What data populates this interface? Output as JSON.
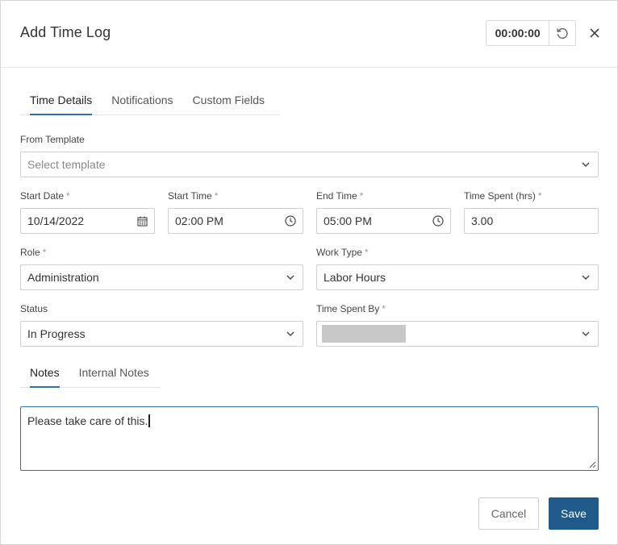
{
  "dialog": {
    "title": "Add Time Log",
    "timer": "00:00:00"
  },
  "tabs": [
    {
      "label": "Time Details",
      "active": true
    },
    {
      "label": "Notifications",
      "active": false
    },
    {
      "label": "Custom Fields",
      "active": false
    }
  ],
  "form": {
    "from_template": {
      "label": "From Template",
      "placeholder": "Select template"
    },
    "start_date": {
      "label": "Start Date",
      "required": "*",
      "value": "10/14/2022"
    },
    "start_time": {
      "label": "Start Time",
      "required": "*",
      "value": "02:00 PM"
    },
    "end_time": {
      "label": "End Time",
      "required": "*",
      "value": "05:00 PM"
    },
    "time_spent": {
      "label": "Time Spent (hrs)",
      "required": "*",
      "value": "3.00"
    },
    "role": {
      "label": "Role",
      "required": "*",
      "value": "Administration"
    },
    "work_type": {
      "label": "Work Type",
      "required": "*",
      "value": "Labor Hours"
    },
    "status": {
      "label": "Status",
      "value": "In Progress"
    },
    "time_spent_by": {
      "label": "Time Spent By",
      "required": "*",
      "value": ""
    }
  },
  "notes_tabs": [
    {
      "label": "Notes",
      "active": true
    },
    {
      "label": "Internal Notes",
      "active": false
    }
  ],
  "notes": {
    "value": "Please take care of this."
  },
  "buttons": {
    "cancel": "Cancel",
    "save": "Save"
  },
  "colors": {
    "accent": "#2d6fb3",
    "primary_button": "#1f5a8a"
  }
}
